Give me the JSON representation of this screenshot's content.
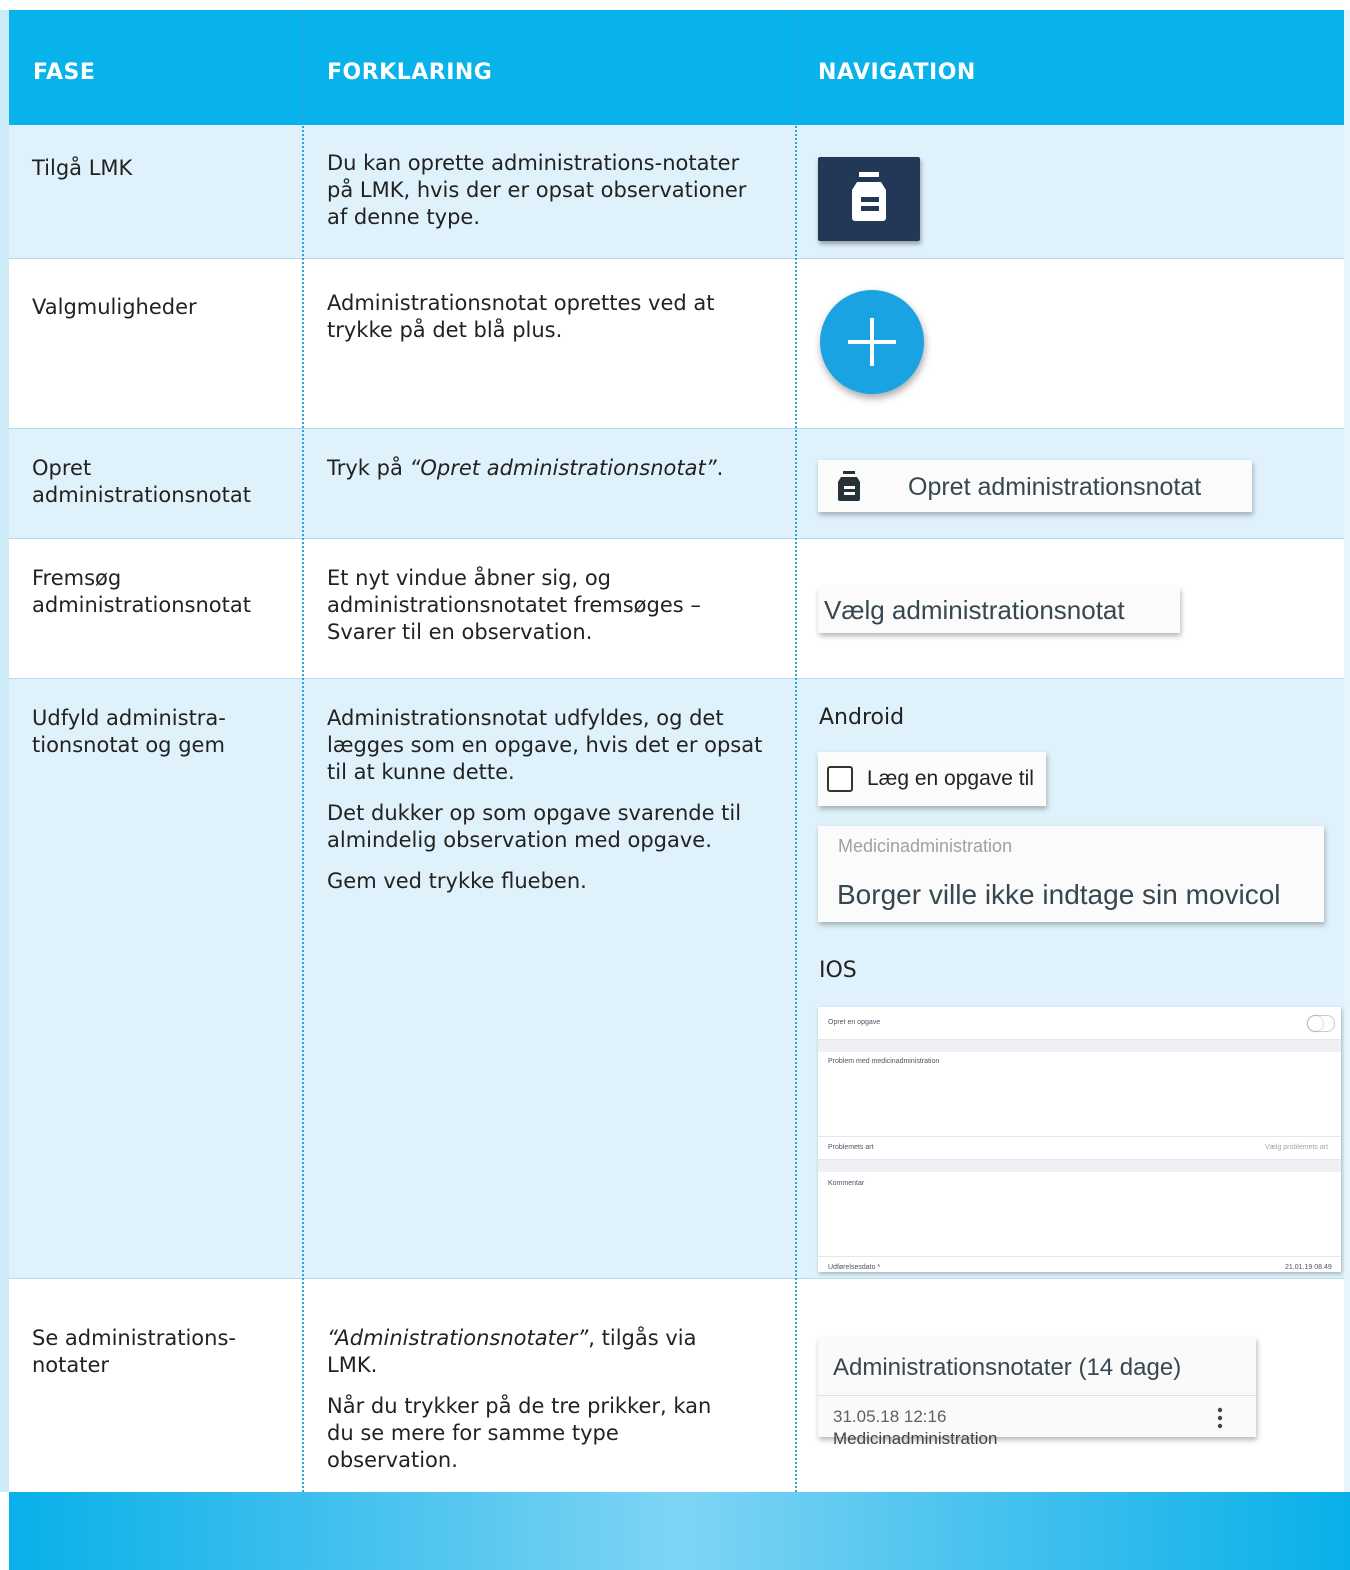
{
  "header": {
    "col_fase": "FASE",
    "col_forklaring": "FORKLARING",
    "col_navigation": "NAVIGATION"
  },
  "rows": [
    {
      "fase": "Tilgå LMK",
      "forklaring": [
        "Du kan oprette administrations-notater på LMK, hvis der er opsat observationer af denne type."
      ],
      "nav_icon": "medicine-bottle-icon"
    },
    {
      "fase": "Valgmuligheder",
      "forklaring": [
        "Administrationsnotat oprettes ved at trykke på det blå plus."
      ],
      "nav_icon": "plus-icon",
      "nav_color": "#1aa3e2"
    },
    {
      "fase": "Opret administrationsnotat",
      "forklaring_prefix": "Tryk på ",
      "forklaring_italic": "“Opret administrationsnotat”",
      "forklaring_suffix": ".",
      "nav_button": "Opret administrationsnotat"
    },
    {
      "fase": "Fremsøg administrationsnotat",
      "forklaring": [
        "Et nyt vindue åbner sig, og administrationsnotatet fremsøges – Svarer til en observation."
      ],
      "nav_label": "Vælg administrationsnotat"
    },
    {
      "fase": "Udfyld administra-tionsnotat og gem",
      "forklaring": [
        "Administrationsnotat udfyldes, og det lægges som en opgave, hvis det er opsat til at kunne dette.",
        "Det dukker op som opgave svarende til almindelig observation med opgave.",
        "Gem ved trykke flueben."
      ],
      "android": {
        "title": "Android",
        "checkbox_label": "Læg en opgave til",
        "field_label": "Medicinadministration",
        "field_value": "Borger ville ikke indtage sin movicol"
      },
      "ios": {
        "title": "IOS",
        "toggle_label": "Opret en opgave",
        "problem_label": "Problem med medicinadministration",
        "art_label": "Problemets art",
        "art_placeholder": "Vælg problemets art",
        "kommentar_label": "Kommentar",
        "date_label": "Udførelsesdato *",
        "date_value": "21.01.19 08.49"
      }
    },
    {
      "fase": "Se administrations-notater",
      "forklaring_italic": "“Administrationsnotater”",
      "forklaring_rest": ", tilgås via LMK.",
      "forklaring2": "Når du trykker på de tre prikker, kan du se mere for samme type observation.",
      "card": {
        "title": "Administrationsnotater (14 dage)",
        "date": "31.05.18 12:16",
        "type": "Medicinadministration"
      }
    }
  ],
  "colors": {
    "header_blue": "#07b3ea",
    "row_shade": "#dff1fa",
    "divider": "#2aa6dc",
    "icon_tile": "#233756"
  }
}
